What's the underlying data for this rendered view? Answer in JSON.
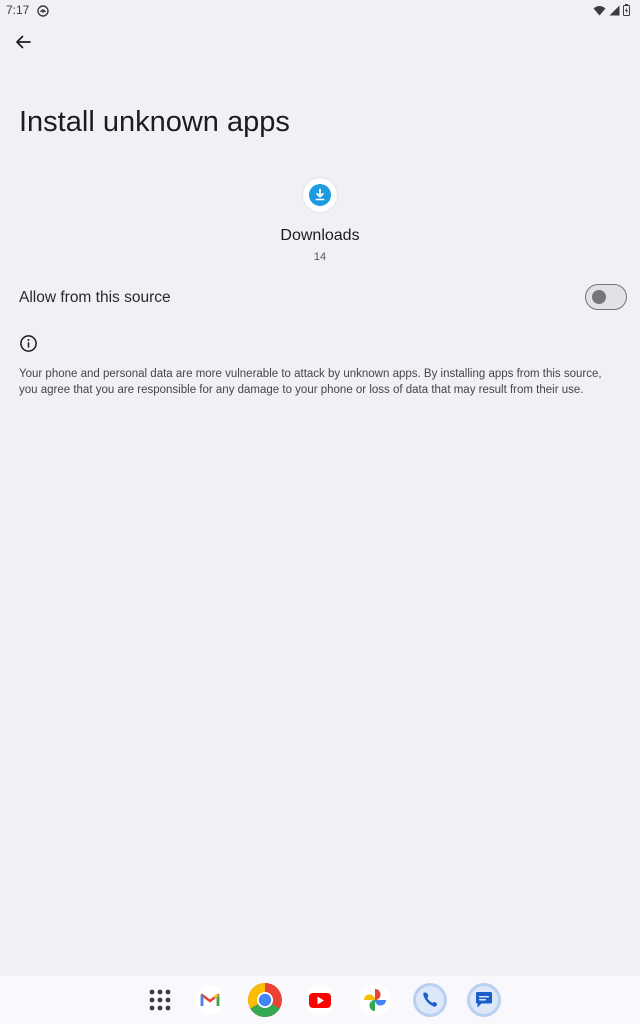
{
  "status_bar": {
    "time": "7:17",
    "icons": [
      "notification-icon",
      "wifi-icon",
      "signal-icon",
      "battery-icon"
    ]
  },
  "header": {
    "back_icon": "arrow-back-icon",
    "title": "Install unknown apps"
  },
  "app": {
    "icon": "download-icon",
    "name": "Downloads",
    "version": "14"
  },
  "setting": {
    "label": "Allow from this source",
    "enabled": false
  },
  "info": {
    "icon": "info-icon",
    "text": "Your phone and personal data are more vulnerable to attack by unknown apps. By installing apps from this source, you agree that you are responsible for any damage to your phone or loss of data that may result from their use."
  },
  "dock": {
    "items": [
      "app-drawer",
      "gmail",
      "chrome",
      "youtube",
      "photos",
      "phone",
      "messages"
    ]
  },
  "colors": {
    "background": "#f1f0f6",
    "download_blue": "#1e9be0",
    "toggle_outline": "#76757c",
    "dock_ring": "#b9d0f0"
  }
}
